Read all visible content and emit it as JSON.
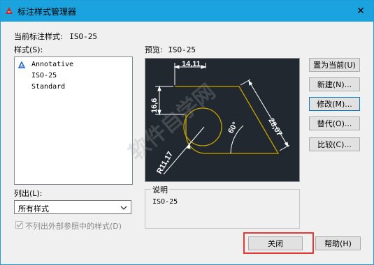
{
  "window": {
    "title": "标注样式管理器",
    "close_glyph": "✕",
    "title_bar_color": "#1ba3e0"
  },
  "current_style": {
    "label": "当前标注样式:",
    "value": "ISO-25"
  },
  "styles": {
    "label": "样式(S):",
    "items": [
      {
        "label": "Annotative",
        "icon": "annotative-triangle-icon"
      },
      {
        "label": "ISO-25"
      },
      {
        "label": "Standard"
      }
    ]
  },
  "preview": {
    "label": "预览:",
    "style_name": "ISO-25",
    "dims": {
      "top": "14,11",
      "left": "16,6",
      "diag": "28,07",
      "angle": "60°",
      "radius": "R11,17"
    },
    "colors": {
      "background": "#212830",
      "geometry": "#c8a400",
      "dimension": "#ffffff"
    }
  },
  "list_filter": {
    "label": "列出(L):",
    "selected": "所有样式"
  },
  "xref_checkbox": {
    "label": "不列出外部参照中的样式(D)",
    "checked": true
  },
  "description": {
    "label": "说明",
    "text": "ISO-25"
  },
  "buttons": {
    "set_current": "置为当前(U)",
    "new": "新建(N)...",
    "modify": "修改(M)...",
    "override": "替代(O)...",
    "compare": "比较(C)...",
    "close": "关闭",
    "help": "帮助(H)"
  },
  "highlight_color": "#e53935",
  "watermark": "软件自学网"
}
